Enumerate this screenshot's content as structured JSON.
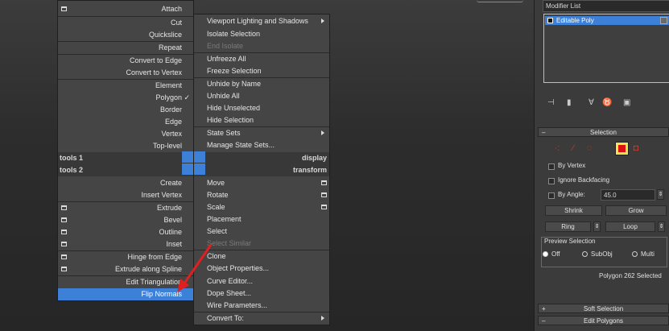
{
  "left_quad": {
    "items": [
      {
        "label": "Attach",
        "checkbox": true
      },
      {
        "label": "Cut"
      },
      {
        "label": "Quickslice"
      },
      {
        "label": "Repeat"
      },
      {
        "label": "Convert to Edge"
      },
      {
        "label": "Convert to Vertex"
      },
      {
        "label": "Element"
      },
      {
        "label": "Polygon",
        "checked": true
      },
      {
        "label": "Border"
      },
      {
        "label": "Edge"
      },
      {
        "label": "Vertex"
      },
      {
        "label": "Top-level"
      },
      {
        "label": "Create"
      },
      {
        "label": "Insert Vertex"
      },
      {
        "label": "Extrude",
        "checkbox": true
      },
      {
        "label": "Bevel",
        "checkbox": true
      },
      {
        "label": "Outline",
        "checkbox": true
      },
      {
        "label": "Inset",
        "checkbox": true
      },
      {
        "label": "Hinge from Edge",
        "checkbox": true
      },
      {
        "label": "Extrude along Spline",
        "checkbox": true
      },
      {
        "label": "Edit Triangulation"
      },
      {
        "label": "Flip Normals",
        "selected": true
      }
    ],
    "bars": [
      {
        "left": "tools 1",
        "right": "display"
      },
      {
        "left": "tools 2",
        "right": "transform"
      }
    ]
  },
  "right_quad": {
    "items": [
      {
        "label": "Viewport Lighting and Shadows",
        "submenu": true
      },
      {
        "label": "Isolate Selection"
      },
      {
        "label": "End Isolate",
        "disabled": true
      },
      {
        "label": "Unfreeze All"
      },
      {
        "label": "Freeze Selection"
      },
      {
        "label": "Unhide by Name"
      },
      {
        "label": "Unhide All"
      },
      {
        "label": "Hide Unselected"
      },
      {
        "label": "Hide Selection"
      },
      {
        "label": "State Sets",
        "submenu": true
      },
      {
        "label": "Manage State Sets..."
      },
      {
        "label": "Move",
        "checkbox": true
      },
      {
        "label": "Rotate",
        "checkbox": true
      },
      {
        "label": "Scale",
        "checkbox": true
      },
      {
        "label": "Placement"
      },
      {
        "label": "Select"
      },
      {
        "label": "Select Similar",
        "disabled": true
      },
      {
        "label": "Clone"
      },
      {
        "label": "Object Properties..."
      },
      {
        "label": "Curve Editor..."
      },
      {
        "label": "Dope Sheet..."
      },
      {
        "label": "Wire Parameters..."
      },
      {
        "label": "Convert To:",
        "submenu": true
      }
    ]
  },
  "panel": {
    "modifier_list": "Modifier List",
    "stack_item": "Editable Poly",
    "selection": {
      "title": "Selection",
      "by_vertex": "By Vertex",
      "ignore_backfacing": "Ignore Backfacing",
      "by_angle": "By Angle:",
      "angle_value": "45.0",
      "shrink": "Shrink",
      "grow": "Grow",
      "ring": "Ring",
      "loop": "Loop",
      "preview_title": "Preview Selection",
      "preview_off": "Off",
      "preview_subobj": "SubObj",
      "preview_multi": "Multi",
      "status": "Polygon 262 Selected"
    },
    "soft_selection": "Soft Selection",
    "edit_polygons": "Edit Polygons"
  },
  "colors": {
    "highlight": "#3d80d8",
    "arrow": "#e02020",
    "active_subobj": "#f0e64c"
  }
}
